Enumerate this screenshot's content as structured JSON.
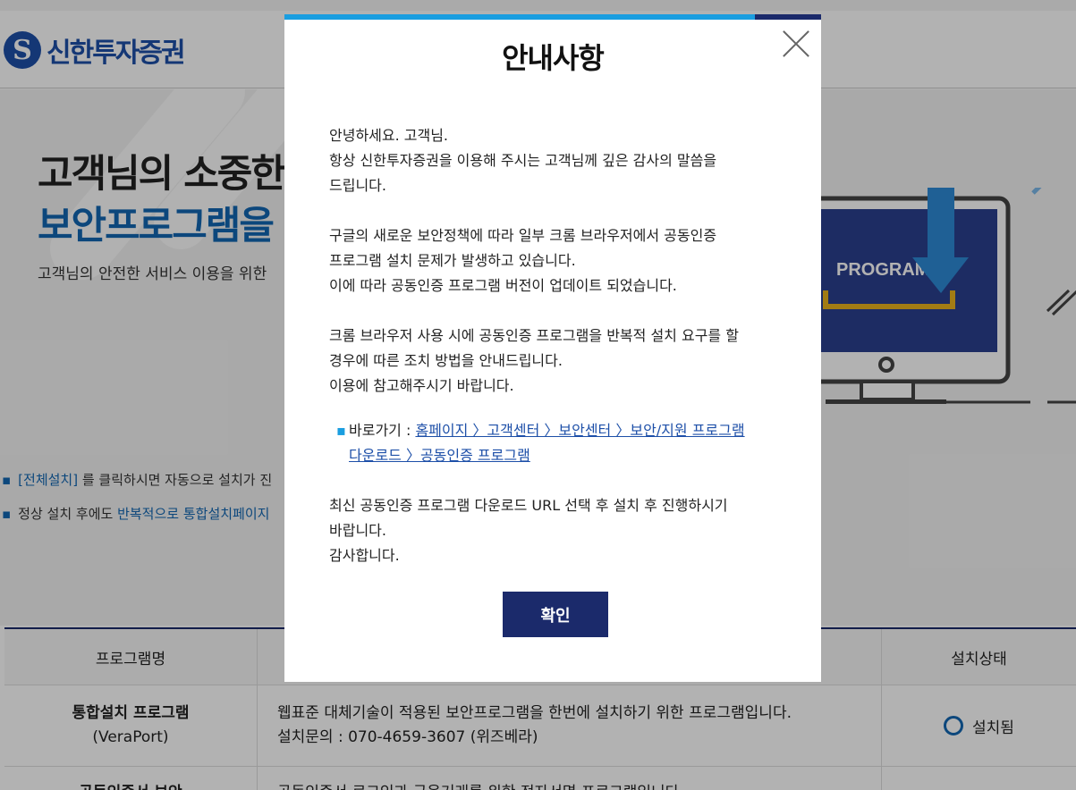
{
  "site": {
    "logo_text": "신한투자증권"
  },
  "hero": {
    "title_line1": "고객님의 소중한",
    "title_line2": "보안프로그램을",
    "subtitle": "고객님의 안전한 서비스 이용을 위한",
    "notes": [
      {
        "prefix": "[전체설치]",
        "text": " 를 클릭하시면 자동으로 설치가 진"
      },
      {
        "prefix": "정상 설치 후에도 ",
        "text": "반복적으로 통합설치페이지"
      }
    ],
    "monitor_label": "PROGRAM"
  },
  "table": {
    "headers": [
      "프로그램명",
      "",
      "설치상태"
    ],
    "rows": [
      {
        "name": "통합설치 프로그램",
        "name_sub": "(VeraPort)",
        "desc_line1": "웹표준 대체기술이 적용된 보안프로그램을 한번에 설치하기 위한 프로그램입니다.",
        "desc_line2": "설치문의 : 070-4659-3607 (위즈베라)",
        "status": "설치됨"
      },
      {
        "name": "공동인증서 보안",
        "desc_line1": "공동인증서 로그인과 금융거래를 위한 전자서명 프로그램입니다."
      }
    ]
  },
  "modal": {
    "title": "안내사항",
    "paragraphs": [
      [
        "안녕하세요. 고객님.",
        "항상 신한투자증권을 이용해 주시는 고객님께 깊은 감사의 말씀을",
        "드립니다."
      ],
      [
        "구글의 새로운 보안정책에 따라 일부 크롬 브라우저에서 공동인증",
        "프로그램 설치 문제가 발생하고 있습니다.",
        "이에 따라 공동인증 프로그램 버전이 업데이트 되었습니다."
      ],
      [
        "크롬 브라우저 사용 시에 공동인증 프로그램을 반복적 설치 요구를 할",
        "경우에 따른 조치 방법을 안내드립니다.",
        "이용에 참고해주시기 바랍니다."
      ]
    ],
    "shortcut_label": "바로가기 : ",
    "shortcut_link_line1": "홈페이지 〉고객센터 〉보안센터 〉보안/지원 프로그램",
    "shortcut_link_line2": "다운로드 〉공동인증 프로그램",
    "closing": [
      "최신 공동인증 프로그램 다운로드 URL 선택 후 설치 후 진행하시기",
      "바랍니다.",
      "감사합니다."
    ],
    "ok_label": "확인"
  }
}
